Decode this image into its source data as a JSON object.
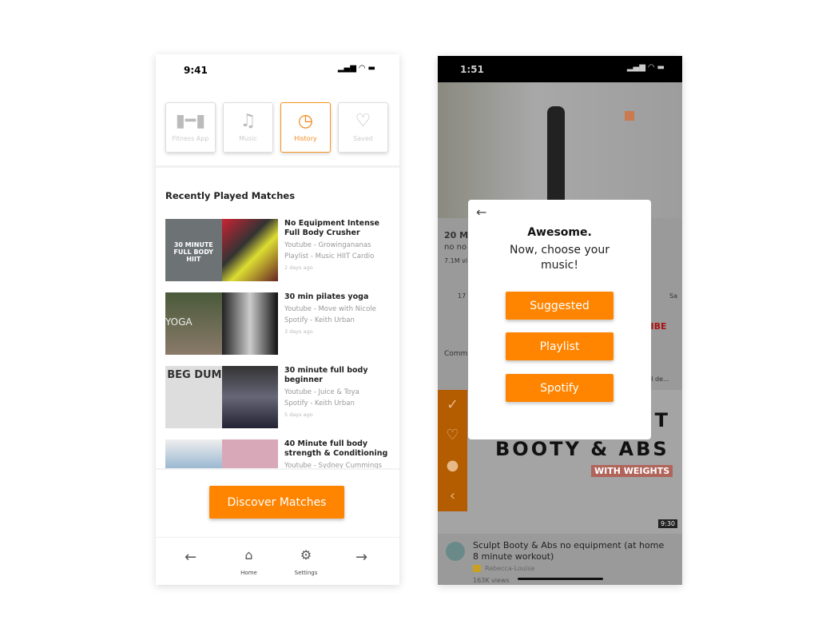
{
  "left": {
    "status_time": "9:41",
    "tabs": [
      {
        "label": "Fitness App",
        "icon": "dumbbell-icon"
      },
      {
        "label": "Music",
        "icon": "music-note-icon"
      },
      {
        "label": "History",
        "icon": "clock-icon",
        "active": true
      },
      {
        "label": "Saved",
        "icon": "heart-icon"
      }
    ],
    "section_title": "Recently Played Matches",
    "items": [
      {
        "title": "No Equipment Intense Full Body Crusher",
        "line1": "Youtube - Growingananas",
        "line2": "Playlist - Music HIIT Cardio",
        "date": "2 days ago",
        "thumb_text": "30 MINUTE FULL BODY HIIT"
      },
      {
        "title": "30 min pilates yoga",
        "line1": "Youtube - Move with Nicole",
        "line2": "Spotify - Keith Urban",
        "date": "3 days ago",
        "thumb_text": "YOGA"
      },
      {
        "title": "30 minute full body beginner",
        "line1": "Youtube - Juice & Toya",
        "line2": "Spotify - Keith Urban",
        "date": "5 days ago",
        "thumb_text": "BEG DUM"
      },
      {
        "title": "40 Minute full body strength & Conditioning",
        "line1": "Youtube - Sydney Cummings",
        "line2": "",
        "date": "",
        "thumb_text": ""
      }
    ],
    "discover_label": "Discover Matches",
    "nav": {
      "home": "Home",
      "settings": "Settings"
    },
    "accent": "#ff8400"
  },
  "right": {
    "status_time": "1:51",
    "bg": {
      "title_frag": "20 MI",
      "sub_frag": "no no",
      "views_frag": "7.1M vi",
      "likes_frag": "17",
      "save_frag": "Sa",
      "subscribe_frag": "CRIBE",
      "comments_frag": "Comm",
      "comment_frag": ", I de...",
      "thumb_t": "T",
      "thumb_title": "BOOTY & ABS",
      "thumb_sub": "WITH WEIGHTS",
      "duration": "9:30",
      "video_title": "Sculpt Booty & Abs no equipment (at home 8 minute workout)",
      "channel": "Rebecca-Louise",
      "views": "163K views"
    },
    "modal": {
      "heading": "Awesome.",
      "prompt": "Now, choose your music!",
      "options": [
        "Suggested",
        "Playlist",
        "Spotify"
      ]
    }
  }
}
